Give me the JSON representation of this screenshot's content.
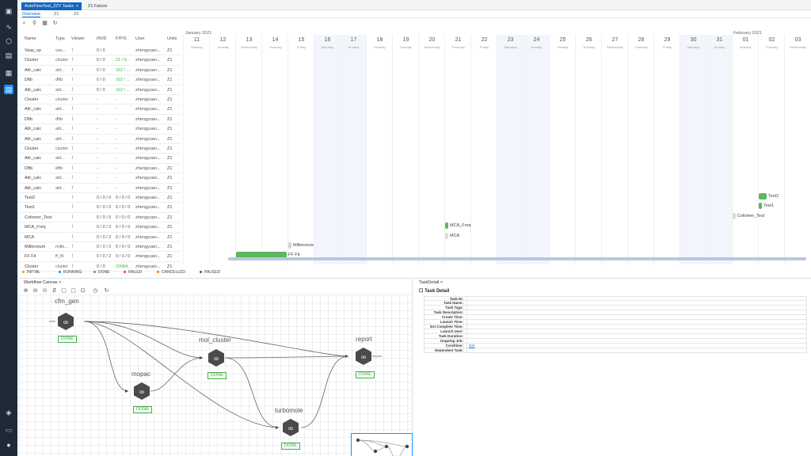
{
  "tabs": [
    {
      "label": "AutoFlowTest_ZZY Tasks",
      "close": "×"
    },
    {
      "label": "Z1 Falcon"
    }
  ],
  "subtabs": [
    "Overview",
    "Z1",
    "Z2"
  ],
  "table": {
    "headers": {
      "name": "Name",
      "type": "Type",
      "viewer": "Viewer",
      "irid": "I/R/D",
      "fps": "F/P/S",
      "user": "User",
      "units": "Units"
    },
    "rows": [
      {
        "name": "Vasp_sp",
        "type": "vas...",
        "irid": "0 / 0",
        "fps": "",
        "user": "zhengyuan...",
        "units": "Z1"
      },
      {
        "name": "Cluster",
        "type": "cluster",
        "irid": "0 / 0",
        "fps": "21 / 5...",
        "fps_green": true,
        "user": "zhengyuan...",
        "units": "Z1"
      },
      {
        "name": "Atlr_calc",
        "type": "atlr...",
        "irid": "0 / 0",
        "fps": "162 / ...",
        "fps_green": true,
        "user": "zhengyuan...",
        "units": "Z1"
      },
      {
        "name": "Dftb",
        "type": "dftb",
        "irid": "0 / 0",
        "fps": "162 / ...",
        "fps_green": true,
        "user": "zhengyuan...",
        "units": "Z1"
      },
      {
        "name": "Atlr_calc",
        "type": "atlr...",
        "irid": "0 / 0",
        "fps": "162 / ...",
        "fps_green": true,
        "user": "zhengyuan...",
        "units": "Z1"
      },
      {
        "name": "Cluster",
        "type": "cluster",
        "irid": "-",
        "fps": "-",
        "user": "zhengyuan...",
        "units": "Z1"
      },
      {
        "name": "Atlr_calc",
        "type": "atlr...",
        "irid": "-",
        "fps": "-",
        "user": "zhengyuan...",
        "units": "Z1"
      },
      {
        "name": "Dftb",
        "type": "dftb",
        "irid": "-",
        "fps": "-",
        "user": "zhengyuan...",
        "units": "Z1"
      },
      {
        "name": "Atlr_calc",
        "type": "atlr...",
        "irid": "-",
        "fps": "-",
        "user": "zhengyuan...",
        "units": "Z1"
      },
      {
        "name": "Atlr_calc",
        "type": "atlr...",
        "irid": "-",
        "fps": "-",
        "user": "zhengyuan...",
        "units": "Z1"
      },
      {
        "name": "Cluster",
        "type": "cluster",
        "irid": "-",
        "fps": "-",
        "user": "zhengyuan...",
        "units": "Z1"
      },
      {
        "name": "Atlr_calc",
        "type": "atlr...",
        "irid": "-",
        "fps": "-",
        "user": "zhengyuan...",
        "units": "Z1"
      },
      {
        "name": "Dftb",
        "type": "dftb",
        "irid": "-",
        "fps": "-",
        "user": "zhengyuan...",
        "units": "Z1"
      },
      {
        "name": "Atlr_calc",
        "type": "atlr...",
        "irid": "-",
        "fps": "-",
        "user": "zhengyuan...",
        "units": "Z1"
      },
      {
        "name": "Atlr_calc",
        "type": "atlr...",
        "irid": "-",
        "fps": "-",
        "user": "zhengyuan...",
        "units": "Z1"
      },
      {
        "name": "Test2",
        "type": "",
        "irid": "0 / 0 / 0",
        "fps": "0 / 0 / 0",
        "user": "zhengyuan...",
        "units": "Z1"
      },
      {
        "name": "Test1",
        "type": "",
        "irid": "0 / 0 / 0",
        "fps": "0 / 0 / 0",
        "user": "zhengyuan...",
        "units": "Z1"
      },
      {
        "name": "Cofomer_Test",
        "type": "",
        "irid": "0 / 0 / 0",
        "fps": "0 / 0 / 0",
        "user": "zhengyuan...",
        "units": "Z1"
      },
      {
        "name": "MCA_Freq",
        "type": "",
        "irid": "0 / 0 / 2",
        "fps": "0 / 0 / 0",
        "user": "zhengyuan...",
        "units": "Z1"
      },
      {
        "name": "MCA",
        "type": "",
        "irid": "0 / 0 / 2",
        "fps": "0 / 0 / 0",
        "user": "zhengyuan...",
        "units": "Z1"
      },
      {
        "name": "Millennium",
        "type": "mille...",
        "irid": "0 / 0 / 2",
        "fps": "0 / 0 / 0",
        "user": "zhengyuan...",
        "units": "Z1"
      },
      {
        "name": "FF Fit",
        "type": "ff_fit",
        "irid": "0 / 0 / 2",
        "fps": "0 / 0 / 0",
        "user": "zhengyuan...",
        "units": "Z1"
      },
      {
        "name": "Cluster",
        "type": "cluster",
        "irid": "0 / 0",
        "fps": "10684...",
        "fps_green": true,
        "user": "zhengyuan...",
        "units": "Z1"
      }
    ]
  },
  "gantt": {
    "months": [
      {
        "label": "January 2021"
      },
      {
        "label": "February 2021"
      }
    ],
    "days": [
      {
        "day": "11",
        "dow": "Monday"
      },
      {
        "day": "12",
        "dow": "Tuesday"
      },
      {
        "day": "13",
        "dow": "Wednesday"
      },
      {
        "day": "14",
        "dow": "Thursday"
      },
      {
        "day": "15",
        "dow": "Friday"
      },
      {
        "day": "16",
        "dow": "Saturday",
        "weekend": true
      },
      {
        "day": "17",
        "dow": "Sunday",
        "weekend": true
      },
      {
        "day": "18",
        "dow": "Monday"
      },
      {
        "day": "19",
        "dow": "Tuesday"
      },
      {
        "day": "20",
        "dow": "Wednesday"
      },
      {
        "day": "21",
        "dow": "Thursday"
      },
      {
        "day": "22",
        "dow": "Friday"
      },
      {
        "day": "23",
        "dow": "Saturday",
        "weekend": true
      },
      {
        "day": "24",
        "dow": "Sunday",
        "weekend": true
      },
      {
        "day": "25",
        "dow": "Monday"
      },
      {
        "day": "26",
        "dow": "Tuesday"
      },
      {
        "day": "27",
        "dow": "Wednesday"
      },
      {
        "day": "28",
        "dow": "Thursday"
      },
      {
        "day": "29",
        "dow": "Friday"
      },
      {
        "day": "30",
        "dow": "Saturday",
        "weekend": true
      },
      {
        "day": "31",
        "dow": "Sunday",
        "weekend": true
      },
      {
        "day": "01",
        "dow": "Monday"
      },
      {
        "day": "02",
        "dow": "Tuesday"
      },
      {
        "day": "03",
        "dow": "Wednesday"
      }
    ],
    "tasks": [
      {
        "label": "Test2",
        "row": 15,
        "start": "2021-02-02",
        "end": "2021-02-02",
        "color": "#5cb85c"
      },
      {
        "label": "Test1",
        "row": 16,
        "start": "2021-02-02",
        "end": "2021-02-02",
        "color": "#5cb85c"
      },
      {
        "label": "Cofomer_Test",
        "row": 17,
        "start": "2021-02-01",
        "end": "2021-02-01",
        "color": "#cfe3cf"
      },
      {
        "label": "MCA_Freq",
        "row": 18,
        "start": "2021-01-21",
        "end": "2021-01-21",
        "color": "#5cb85c"
      },
      {
        "label": "MCA",
        "row": 19,
        "start": "2021-01-21",
        "end": "2021-01-21",
        "color": "#cfe3cf"
      },
      {
        "label": "Millennium",
        "row": 20,
        "start": "2021-01-15",
        "end": "2021-01-15",
        "color": "#c6dcc6"
      },
      {
        "label": "FF Fit",
        "row": 21,
        "start": "2021-01-13",
        "end": "2021-01-14",
        "color": "#5cb85c"
      }
    ]
  },
  "legend": [
    {
      "label": "INITIAL",
      "color": "#f0a020"
    },
    {
      "label": "RUNNING",
      "color": "#1890ff"
    },
    {
      "label": "DONE",
      "color": "#4caf50"
    },
    {
      "label": "FAILED",
      "color": "#e53935"
    },
    {
      "label": "CANCELLED",
      "color": "#ff7a00"
    },
    {
      "label": "PAUSED",
      "color": "#8e24aa"
    }
  ],
  "workflow": {
    "title": "Workflow Canvas",
    "close": "×",
    "nodes": [
      {
        "id": "cfm_gen",
        "title": "cfm_gen",
        "status": "DONE"
      },
      {
        "id": "mopac",
        "title": "mopac",
        "status": "DONE"
      },
      {
        "id": "mol_cluster",
        "title": "mol_cluster",
        "status": "DONE"
      },
      {
        "id": "report",
        "title": "report",
        "status": "DONE"
      },
      {
        "id": "turbomole",
        "title": "turbomole",
        "status": "DONE"
      }
    ]
  },
  "task_detail": {
    "tab": "TaskDetail",
    "close": "×",
    "heading": "Task Detail",
    "fields": [
      {
        "label": "Task ID:",
        "value": ""
      },
      {
        "label": "Task Name:",
        "value": ""
      },
      {
        "label": "Task Tags:",
        "value": ""
      },
      {
        "label": "Task Description:",
        "value": ""
      },
      {
        "label": "Create Time:",
        "value": ""
      },
      {
        "label": "Launch Time:",
        "value": ""
      },
      {
        "label": "Est Complete Time:",
        "value": ""
      },
      {
        "label": "Launch User:",
        "value": ""
      },
      {
        "label": "Task Duration:",
        "value": ""
      },
      {
        "label": "Ongoing Job:",
        "value": ""
      },
      {
        "label": "Coreltime:",
        "value": "Get"
      },
      {
        "label": "Dependent Task:",
        "value": ""
      }
    ]
  },
  "icons": {
    "sidebar": [
      "image-icon",
      "chart-icon",
      "cube-icon",
      "box-icon",
      "calendar-icon",
      "tasks-icon",
      "layers-icon",
      "stack-icon",
      "avatar-icon"
    ],
    "toolbar": [
      "search-icon",
      "filter-icon",
      "grid-icon",
      "refresh-icon"
    ]
  }
}
